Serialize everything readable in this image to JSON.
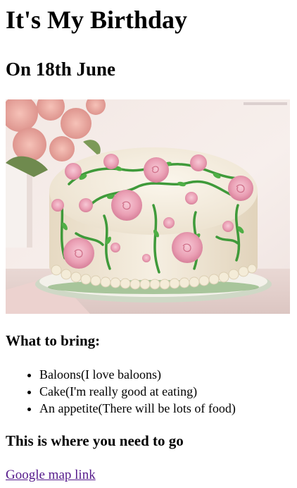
{
  "heading": {
    "title": "It's My Birthday",
    "date": "On 18th June"
  },
  "image": {
    "icon": "birthday-cake-photo"
  },
  "bring": {
    "title": "What to bring:",
    "items": [
      "Baloons(I love baloons)",
      "Cake(I'm really good at eating)",
      "An appetite(There will be lots of food)"
    ]
  },
  "location": {
    "title": "This is where you need to go",
    "link_label": "Google map link"
  },
  "colors": {
    "link_visited": "#551a8b",
    "text": "#000000",
    "background": "#ffffff"
  }
}
